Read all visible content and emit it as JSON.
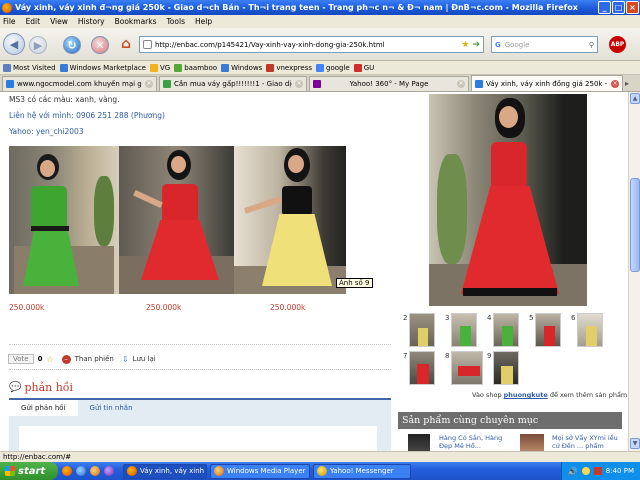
{
  "window": {
    "title": "Váy xinh, váy xinh đ¬ng giá 250k - Giao d¬ch Bán - Th¬i trang teen - Trang ph¬c n¬ & Đ¬ nam | ĐnB¬c.com - Mozilla Firefox",
    "min": "_",
    "max": "□",
    "close": "×"
  },
  "menu": [
    "File",
    "Edit",
    "View",
    "History",
    "Bookmarks",
    "Tools",
    "Help"
  ],
  "nav": {
    "url": "http://enbac.com/p145421/Vay-xinh-vay-xinh-dong-gia-250k.html",
    "search_placeholder": "Google",
    "abp": "ABP"
  },
  "bookmarks": [
    {
      "label": "Most Visited",
      "color": "#5b7fbf"
    },
    {
      "label": "Windows Marketplace",
      "color": "#3a7bd5"
    },
    {
      "label": "VG",
      "color": "#f2b21b"
    },
    {
      "label": "baamboo",
      "color": "#57a639"
    },
    {
      "label": "Windows",
      "color": "#3a7bd5"
    },
    {
      "label": "vnexpress",
      "color": "#c0392b"
    },
    {
      "label": "google",
      "color": "#4285f4"
    },
    {
      "label": "GU",
      "color": "#d12e2e"
    }
  ],
  "tabs": [
    {
      "label": "www.ngocmodel.com khuyến mại giảm ...",
      "active": false,
      "color": "#2a7de1"
    },
    {
      "label": "Cần mua váy gấp!!!!!!!1 - Giao dịch M...",
      "active": false,
      "color": "#3aa040"
    },
    {
      "label": "Yahoo! 360° - My Page",
      "active": false,
      "color": "#7b0099"
    },
    {
      "label": "Váy xinh, váy xinh đồng giá 250k - Gia...",
      "active": true,
      "color": "#2a7de1"
    }
  ],
  "content": {
    "colors_line": "MS3 có các màu: xanh, vàng.",
    "contact_line": "Liên hệ với mình: 0906 251 288 (Phương)",
    "yahoo_line": "Yahoo: yen_chi2003",
    "photos": [
      {
        "name": "green-dress"
      },
      {
        "name": "red-dress"
      },
      {
        "name": "yellow-dress"
      }
    ],
    "prices": [
      "250.000k",
      "250.000k",
      "250.000k"
    ],
    "tooltip": "Ảnh số 9",
    "vote_label": "Vote",
    "vote_count": "0",
    "complain_label": "Than phiền",
    "save_label": "Lưu lại",
    "feedback_title": "phản hồi",
    "reply_tab": "Gửi phản hồi",
    "message_tab": "Gửi tin nhắn"
  },
  "right": {
    "thumb_numbers": [
      "2",
      "3",
      "4",
      "5",
      "6",
      "7",
      "8",
      "9"
    ],
    "shop_prefix": "Vào shop ",
    "shop_name": "phuongkute",
    "shop_suffix": " để xem thêm sản phẩm",
    "same_category": "Sản phẩm cùng chuyên mục",
    "item1": "Hàng Có Sẵn, Hàng Đẹp Mê Hồ...",
    "item2": "Mọi sở Vẩy XYmi iều cứ Đến ... phẩm"
  },
  "status": "http://enbac.com/#",
  "taskbar": {
    "start": "start",
    "tasks": [
      {
        "label": "Váy xinh, váy xinh đồ...",
        "active": true
      },
      {
        "label": "Windows Media Player",
        "active": false
      },
      {
        "label": "Yahoo! Messenger",
        "active": false
      }
    ],
    "time": "8:40 PM"
  }
}
